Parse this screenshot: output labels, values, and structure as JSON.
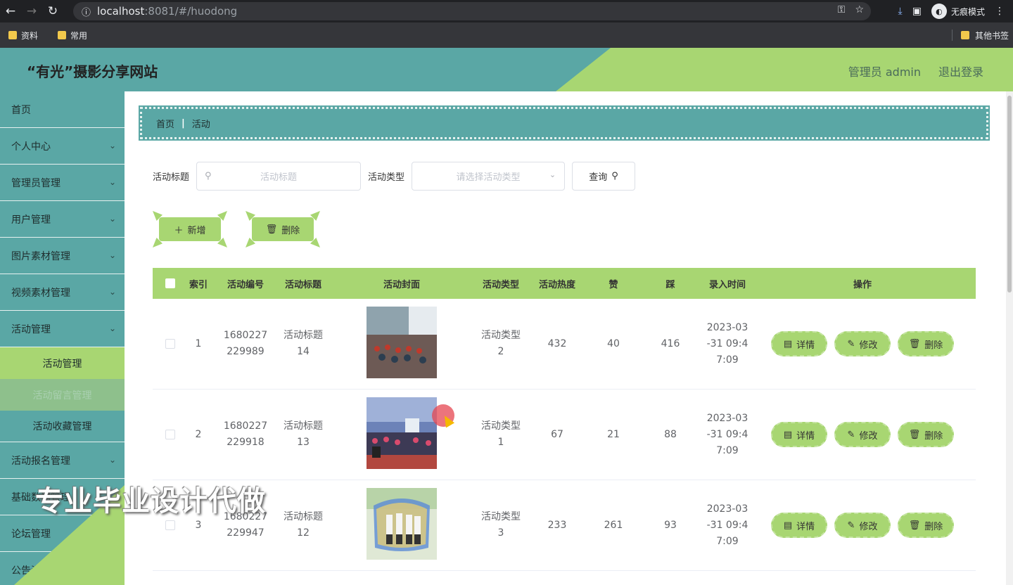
{
  "browser": {
    "url_host": "localhost",
    "url_path": ":8081/#/huodong",
    "incognito_label": "无痕模式",
    "bookmarks": [
      "资料",
      "常用"
    ],
    "bookmarks_right": "其他书签"
  },
  "header": {
    "title": "“有光”摄影分享网站",
    "admin": "管理员 admin",
    "logout": "退出登录"
  },
  "sidebar": {
    "items_top": [
      {
        "label": "首页",
        "chevron": false
      },
      {
        "label": "个人中心",
        "chevron": true
      },
      {
        "label": "管理员管理",
        "chevron": true
      },
      {
        "label": "用户管理",
        "chevron": true
      },
      {
        "label": "图片素材管理",
        "chevron": true
      },
      {
        "label": "视频素材管理",
        "chevron": true
      },
      {
        "label": "活动管理",
        "chevron": true
      }
    ],
    "sub_items": [
      "活动管理",
      "活动留言管理",
      "活动收藏管理"
    ],
    "items_bottom": [
      {
        "label": "活动报名管理",
        "chevron": true
      },
      {
        "label": "基础数据管理",
        "chevron": true
      },
      {
        "label": "论坛管理",
        "chevron": true
      },
      {
        "label": "公告资讯管理",
        "chevron": true
      }
    ]
  },
  "watermark": "专业毕业设计代做",
  "breadcrumb": {
    "home": "首页",
    "current": "活动"
  },
  "search": {
    "title_label": "活动标题",
    "title_placeholder": "活动标题",
    "type_label": "活动类型",
    "type_placeholder": "请选择活动类型",
    "query_btn": "查询"
  },
  "actions": {
    "add": "新增",
    "delete": "删除"
  },
  "table": {
    "headers": [
      "索引",
      "活动编号",
      "活动标题",
      "活动封面",
      "活动类型",
      "活动热度",
      "赞",
      "踩",
      "录入时间",
      "操作"
    ],
    "rows": [
      {
        "index": "1",
        "code": [
          "1680227",
          "229989"
        ],
        "title": [
          "活动标题",
          "14"
        ],
        "type": [
          "活动类型",
          "2"
        ],
        "hot": "432",
        "like": "40",
        "dislike": "416",
        "time": [
          "2023-03",
          "-31 09:4",
          "7:09"
        ]
      },
      {
        "index": "2",
        "code": [
          "1680227",
          "229918"
        ],
        "title": [
          "活动标题",
          "13"
        ],
        "type": [
          "活动类型",
          "1"
        ],
        "hot": "67",
        "like": "21",
        "dislike": "88",
        "time": [
          "2023-03",
          "-31 09:4",
          "7:09"
        ]
      },
      {
        "index": "3",
        "code": [
          "1680227",
          "229947"
        ],
        "title": [
          "活动标题",
          "12"
        ],
        "type": [
          "活动类型",
          "3"
        ],
        "hot": "233",
        "like": "261",
        "dislike": "93",
        "time": [
          "2023-03",
          "-31 09:4",
          "7:09"
        ]
      }
    ],
    "op_labels": {
      "detail": "详情",
      "edit": "修改",
      "delete": "删除"
    }
  },
  "colors": {
    "teal": "#5aa7a5",
    "green": "#a8d672"
  }
}
